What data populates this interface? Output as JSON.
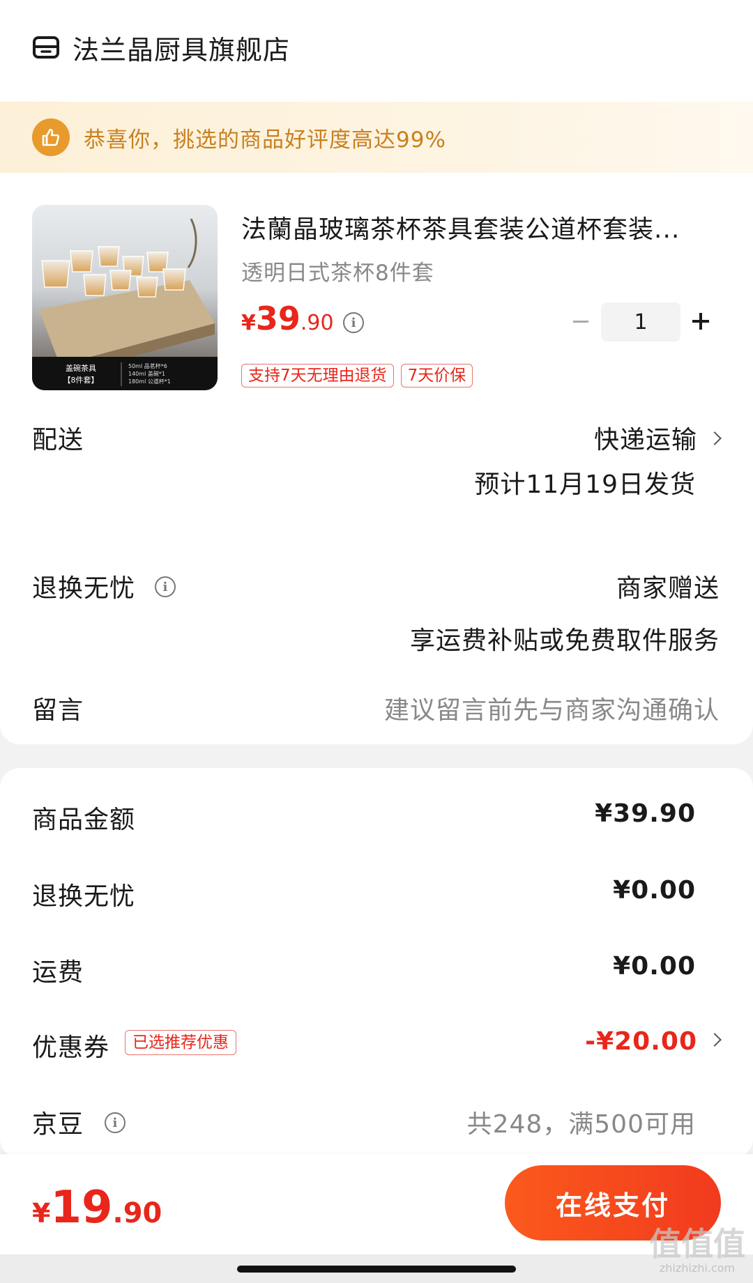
{
  "store": {
    "name": "法兰晶厨具旗舰店",
    "icon": "store-icon"
  },
  "banner": {
    "text": "恭喜你，挑选的商品好评度高达99%",
    "icon": "thumbs-up-icon"
  },
  "product": {
    "title": "法蘭晶玻璃茶杯茶具套装公道杯套装...",
    "spec": "透明日式茶杯8件套",
    "image_caption_line1": "盖碗茶具",
    "image_caption_line2": "【8件套】",
    "image_details": [
      "50ml 品茗杯*6",
      "140ml 盖碗*1",
      "180ml 公道杯*1"
    ],
    "price_symbol": "¥",
    "price_int": "39",
    "price_dec": ".90",
    "quantity": "1",
    "tags": [
      "支持7天无理由退货",
      "7天价保"
    ]
  },
  "delivery": {
    "label": "配送",
    "method": "快递运输",
    "eta": "预计11月19日发货"
  },
  "returns": {
    "label": "退换无忧",
    "value": "商家赠送",
    "sub": "享运费补贴或免费取件服务"
  },
  "message": {
    "label": "留言",
    "placeholder": "建议留言前先与商家沟通确认"
  },
  "summary": {
    "goods_amount_label": "商品金额",
    "goods_amount": "¥39.90",
    "returns_label": "退换无忧",
    "returns_amount": "¥0.00",
    "shipping_label": "运费",
    "shipping_amount": "¥0.00",
    "coupon_label": "优惠券",
    "coupon_tag": "已选推荐优惠",
    "coupon_amount": "-¥20.00",
    "jingdou_label": "京豆",
    "jingdou_value": "共248，满500可用"
  },
  "footer": {
    "total_symbol": "¥",
    "total_int": "19",
    "total_dec": ".90",
    "pay_label": "在线支付"
  },
  "watermark": {
    "mark": "值值值",
    "url": "zhizhizhi.com"
  },
  "colors": {
    "accent_red": "#e8261b",
    "banner_text": "#c9801f",
    "pay_gradient_start": "#fb5a1c",
    "pay_gradient_end": "#f23a1e"
  }
}
